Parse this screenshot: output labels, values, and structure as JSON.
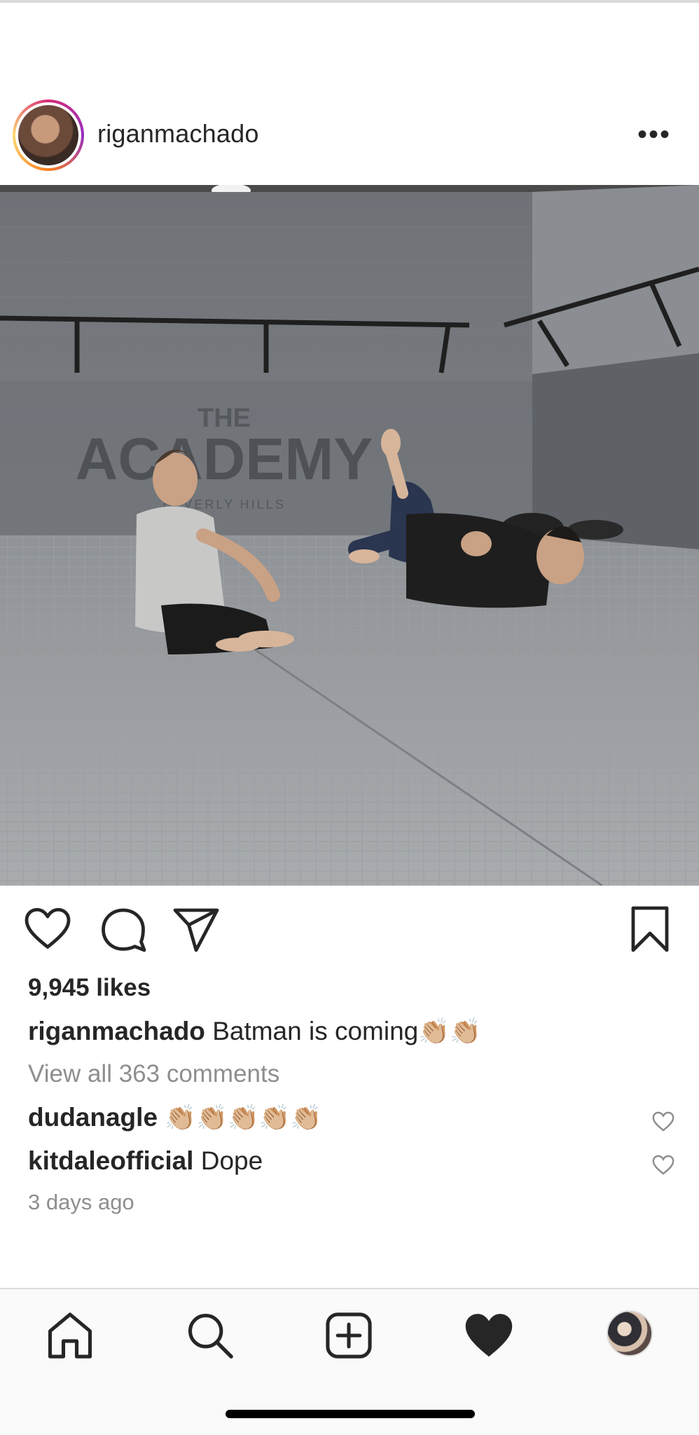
{
  "post": {
    "username": "riganmachado",
    "more_label": "•••",
    "photo_alt": "",
    "likes": "9,945 likes",
    "caption": {
      "username": "riganmachado",
      "text": "Batman is coming",
      "emoji": "👏🏼👏🏼"
    },
    "view_all_comments": "View all 363 comments",
    "comments": [
      {
        "username": "dudanagle",
        "text": "👏🏼👏🏼👏🏼👏🏼👏🏼"
      },
      {
        "username": "kitdaleofficial",
        "text": "Dope"
      }
    ],
    "timestamp": "3 days ago"
  },
  "photo_text": {
    "wall_sign_line1": "THE",
    "wall_sign_line2": "ACADEMY",
    "wall_sign_line3": "BEVERLY HILLS"
  },
  "icons": {
    "like": "heart-outline-icon",
    "comment": "speech-bubble-icon",
    "share": "paper-plane-icon",
    "save": "bookmark-icon",
    "tab_home": "home-icon",
    "tab_search": "search-icon",
    "tab_new_post": "plus-square-icon",
    "tab_activity": "heart-filled-icon",
    "tab_profile": "profile-avatar"
  },
  "colors": {
    "text": "#262626",
    "secondary": "#8e8e8e",
    "divider": "#dbdbdb",
    "tabbar_bg": "#fafafa"
  }
}
